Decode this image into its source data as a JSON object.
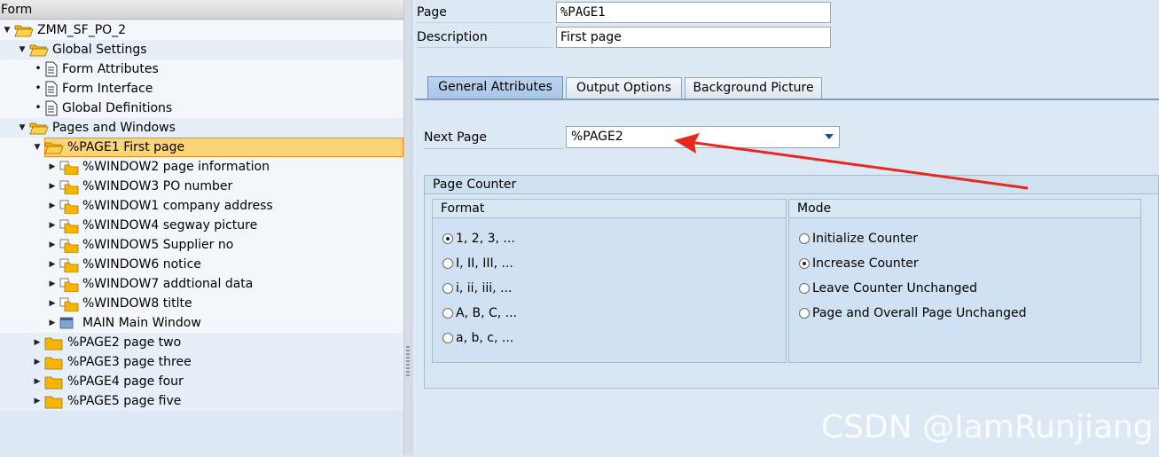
{
  "tree": {
    "header": "Form",
    "rows": [
      {
        "label": "ZMM_SF_PO_2",
        "icon": "open-folder-icon"
      },
      {
        "label": "Global Settings",
        "icon": "open-folder-icon"
      },
      {
        "label": "Form Attributes",
        "icon": "document-icon"
      },
      {
        "label": "Form Interface",
        "icon": "document-icon"
      },
      {
        "label": "Global Definitions",
        "icon": "document-icon"
      },
      {
        "label": "Pages and Windows",
        "icon": "open-folder-icon"
      },
      {
        "label": "%PAGE1 First page",
        "icon": "open-folder-icon"
      },
      {
        "label": "%WINDOW2 page information",
        "icon": "window-folder-icon"
      },
      {
        "label": "%WINDOW3 PO number",
        "icon": "window-folder-icon"
      },
      {
        "label": "%WINDOW1 company address",
        "icon": "window-folder-icon"
      },
      {
        "label": "%WINDOW4 segway picture",
        "icon": "window-folder-icon"
      },
      {
        "label": "%WINDOW5 Supplier no",
        "icon": "window-folder-icon"
      },
      {
        "label": "%WINDOW6 notice",
        "icon": "window-folder-icon"
      },
      {
        "label": "%WINDOW7 addtional data",
        "icon": "window-folder-icon"
      },
      {
        "label": "%WINDOW8 titlte",
        "icon": "window-folder-icon"
      },
      {
        "label": "MAIN Main Window",
        "icon": "main-window-icon"
      },
      {
        "label": "%PAGE2 page two",
        "icon": "folder-icon"
      },
      {
        "label": "%PAGE3 page three",
        "icon": "folder-icon"
      },
      {
        "label": "%PAGE4 page four",
        "icon": "folder-icon"
      },
      {
        "label": "%PAGE5 page five",
        "icon": "folder-icon"
      }
    ]
  },
  "header_fields": {
    "page_label": "Page",
    "page_value": "%PAGE1",
    "description_label": "Description",
    "description_value": "First page"
  },
  "tabs": [
    {
      "label": "General Attributes",
      "active": true
    },
    {
      "label": "Output Options",
      "active": false
    },
    {
      "label": "Background Picture",
      "active": false
    }
  ],
  "next_page": {
    "label": "Next Page",
    "value": "%PAGE2"
  },
  "page_counter": {
    "title": "Page Counter",
    "format": {
      "title": "Format",
      "options": [
        "1, 2, 3, ...",
        "I, II, III, ...",
        "i, ii, iii, ...",
        "A, B, C, ...",
        "a, b, c, ..."
      ],
      "selected_index": 0
    },
    "mode": {
      "title": "Mode",
      "options": [
        "Initialize Counter",
        "Increase Counter",
        "Leave Counter Unchanged",
        "Page and Overall Page Unchanged"
      ],
      "selected_index": 1
    }
  },
  "colors": {
    "selection_fill": "#fcd478",
    "selection_border": "#e98b1e",
    "annotation_arrow": "#e8281e",
    "folder": "#f7b500"
  },
  "watermark": "CSDN @IamRunjiang"
}
